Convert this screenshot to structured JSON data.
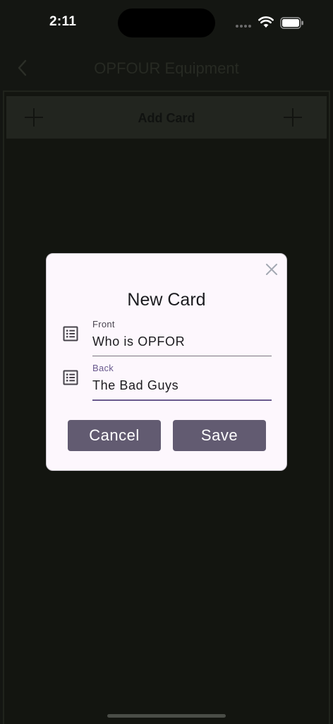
{
  "status_bar": {
    "time": "2:11"
  },
  "nav": {
    "title": "OPFOUR Equipment"
  },
  "add_card_bar": {
    "label": "Add Card"
  },
  "dialog": {
    "title": "New Card",
    "front": {
      "label": "Front",
      "value": "Who is OPFOR"
    },
    "back": {
      "label": "Back",
      "value": "The Bad Guys"
    },
    "cancel_label": "Cancel",
    "save_label": "Save"
  },
  "icons": {
    "back": "chevron-left-icon",
    "add": "plus-icon",
    "close": "close-icon",
    "field": "list-alt-icon"
  },
  "colors": {
    "background": "#141612",
    "dialog_surface": "#fdf7fd",
    "button": "#625b71",
    "accent": "#6a5a8e"
  }
}
